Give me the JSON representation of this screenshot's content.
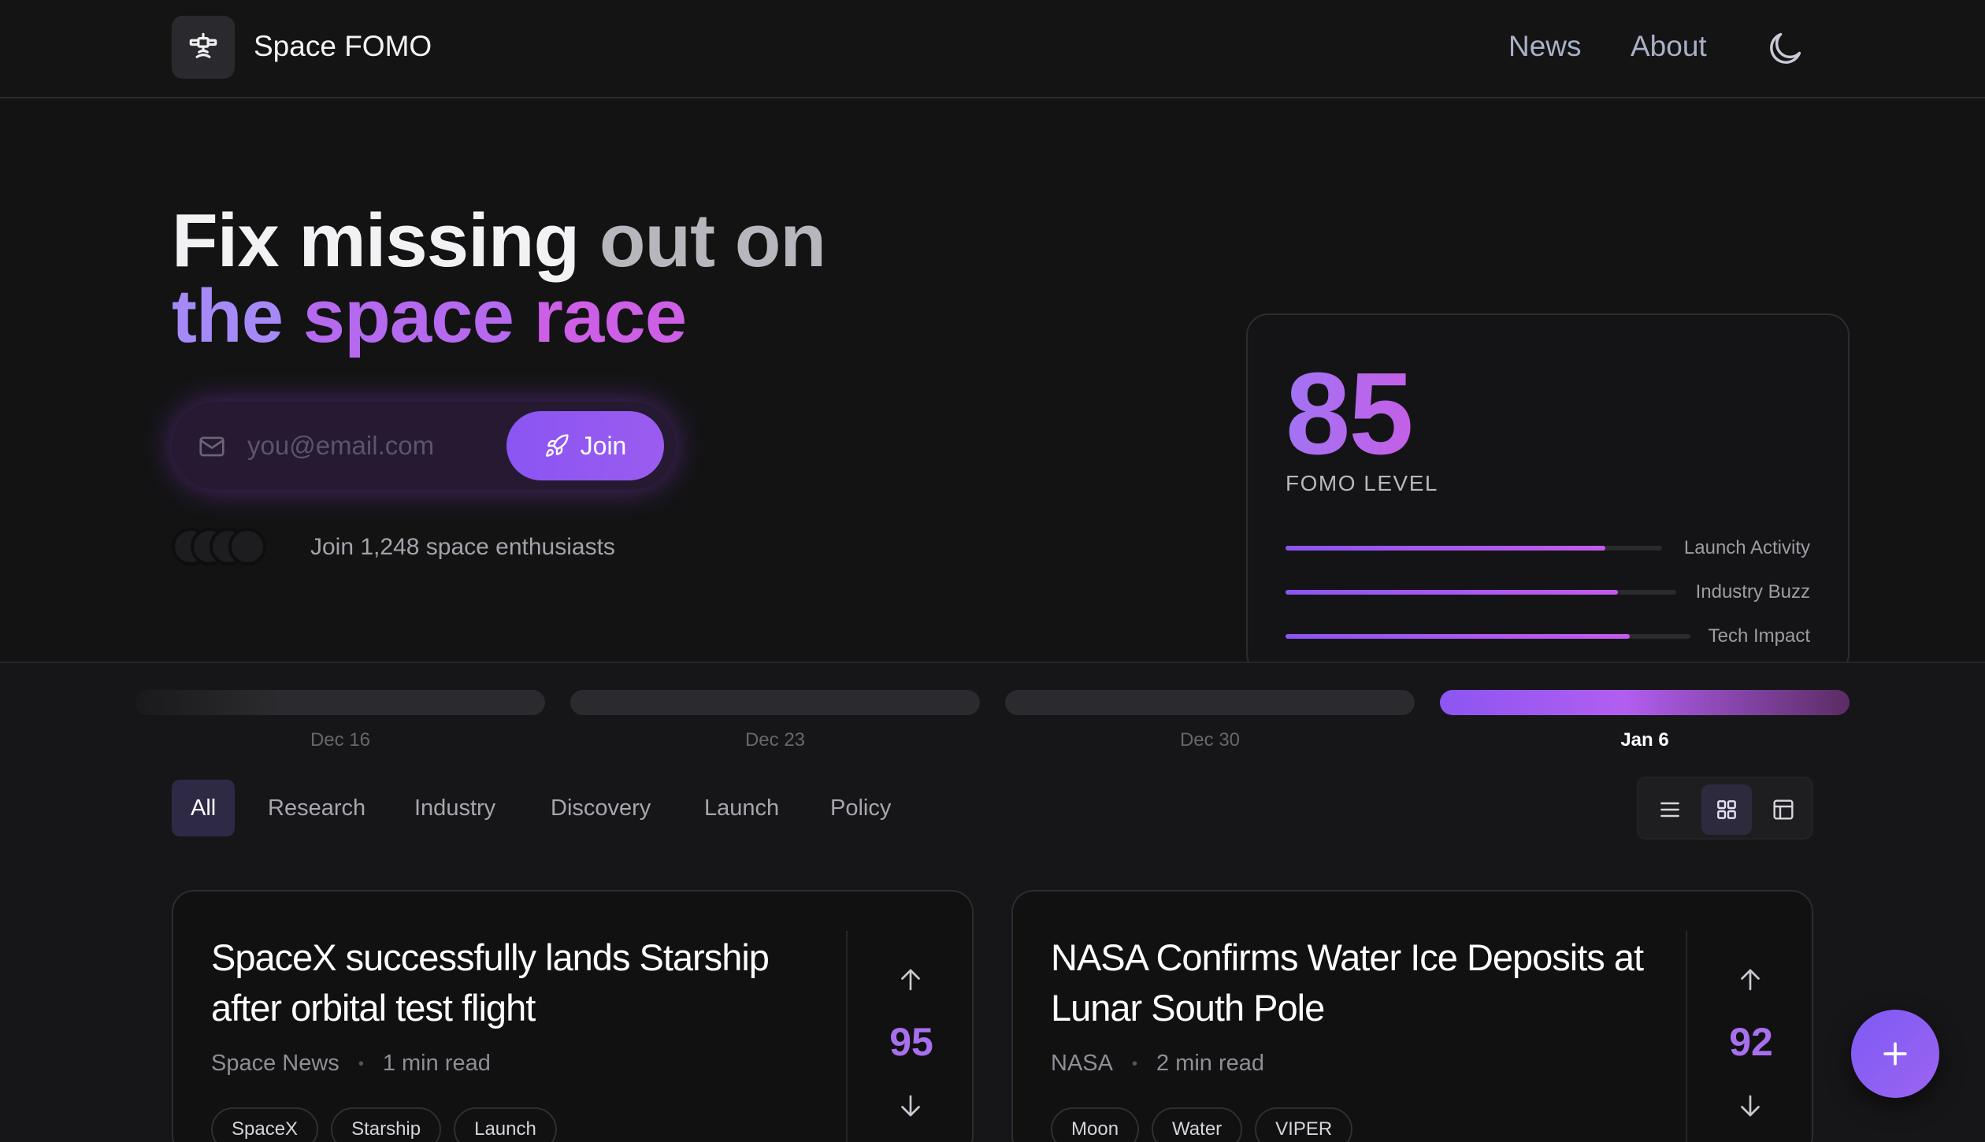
{
  "header": {
    "brand": "Space FOMO",
    "nav": [
      {
        "label": "News"
      },
      {
        "label": "About"
      }
    ],
    "theme_toggle_icon": "moon-icon"
  },
  "hero": {
    "line1_a": "Fix missing ",
    "line1_b": "out on",
    "line2_a": "the ",
    "line2_b": "space ",
    "line2_c": "race",
    "email_placeholder": "you@email.com",
    "join_label": "Join",
    "social_proof": "Join 1,248 space enthusiasts"
  },
  "fomo": {
    "level": "85",
    "label": "FOMO LEVEL",
    "metrics": [
      {
        "label": "Launch Activity",
        "value": 0.85
      },
      {
        "label": "Industry Buzz",
        "value": 0.85
      },
      {
        "label": "Tech Impact",
        "value": 0.85
      }
    ]
  },
  "timeline": {
    "weeks": [
      {
        "label": "Dec 16",
        "active": false
      },
      {
        "label": "Dec 23",
        "active": false
      },
      {
        "label": "Dec 30",
        "active": false
      },
      {
        "label": "Jan 6",
        "active": true
      }
    ]
  },
  "filters": {
    "tabs": [
      {
        "label": "All",
        "active": true
      },
      {
        "label": "Research"
      },
      {
        "label": "Industry"
      },
      {
        "label": "Discovery"
      },
      {
        "label": "Launch"
      },
      {
        "label": "Policy"
      }
    ],
    "views": [
      "list-view-icon",
      "grid-view-icon",
      "layout-view-icon"
    ],
    "active_view": "grid-view-icon"
  },
  "articles": [
    {
      "title": "SpaceX successfully lands Starship after orbital test flight",
      "source": "Space News",
      "read_time": "1 min read",
      "tags": [
        "SpaceX",
        "Starship",
        "Launch"
      ],
      "score": "95"
    },
    {
      "title": "NASA Confirms Water Ice Deposits at Lunar South Pole",
      "source": "NASA",
      "read_time": "2 min read",
      "tags": [
        "Moon",
        "Water",
        "VIPER"
      ],
      "score": "92"
    }
  ],
  "colors": {
    "accent": "#8b5cf6",
    "accent_pink": "#c75fe8",
    "background": "#131314"
  }
}
